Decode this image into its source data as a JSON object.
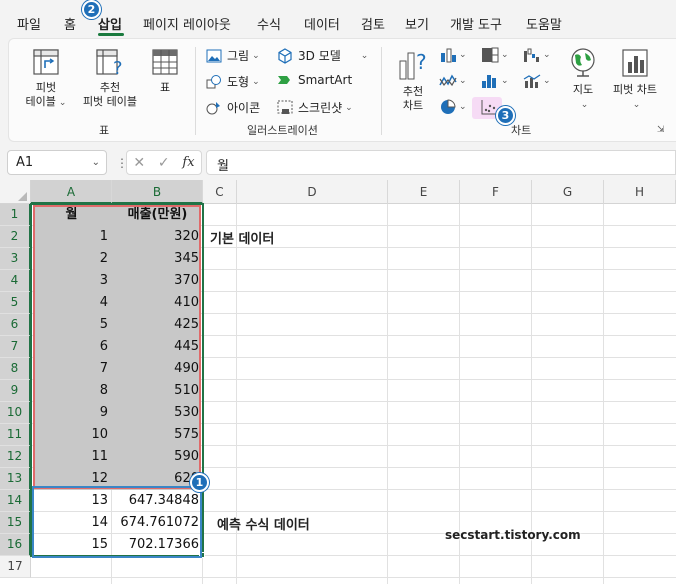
{
  "menu": {
    "tabs": [
      "파일",
      "홈",
      "삽입",
      "페이지 레이아웃",
      "수식",
      "데이터",
      "검토",
      "보기",
      "개발 도구",
      "도움말"
    ],
    "active_tab": "삽입"
  },
  "ribbon": {
    "tables_group": {
      "label": "표",
      "pivot_table": "피벗\n테이블",
      "recommended_pivot": "추천\n피벗 테이블",
      "table": "표"
    },
    "illustrations_group": {
      "label": "일러스트레이션",
      "picture": "그림",
      "shapes": "도형",
      "icons": "아이콘",
      "models_3d": "3D 모델",
      "smartart": "SmartArt",
      "screenshot": "스크린샷"
    },
    "charts_group": {
      "label": "차트",
      "recommended_charts": "추천\n차트",
      "maps": "지도",
      "pivot_chart": "피벗 차트"
    }
  },
  "formula_bar": {
    "name_box": "A1",
    "formula": "월"
  },
  "sheet": {
    "columns": [
      "A",
      "B",
      "C",
      "D",
      "E",
      "F",
      "G",
      "H"
    ],
    "rows": [
      "1",
      "2",
      "3",
      "4",
      "5",
      "6",
      "7",
      "8",
      "9",
      "10",
      "11",
      "12",
      "13",
      "14",
      "15",
      "16",
      "17"
    ],
    "header": [
      "월",
      "매출(만원)"
    ],
    "data": [
      [
        "1",
        "320"
      ],
      [
        "2",
        "345"
      ],
      [
        "3",
        "370"
      ],
      [
        "4",
        "410"
      ],
      [
        "5",
        "425"
      ],
      [
        "6",
        "445"
      ],
      [
        "7",
        "490"
      ],
      [
        "8",
        "510"
      ],
      [
        "9",
        "530"
      ],
      [
        "10",
        "575"
      ],
      [
        "11",
        "590"
      ],
      [
        "12",
        "620"
      ],
      [
        "13",
        "647.34848"
      ],
      [
        "14",
        "674.761072"
      ],
      [
        "15",
        "702.17366"
      ]
    ]
  },
  "annotations": {
    "base_data": "기본 데이터",
    "forecast_data": "예측 수식 데이터",
    "watermark": "secstart.tistory.com",
    "badge1": "1",
    "badge2": "2",
    "badge3": "3"
  },
  "colors": {
    "excel_green": "#217346",
    "red_box": "#e06a6a",
    "blue_box": "#3a86c6",
    "badge": "#1f6fb8",
    "scatter_highlight": "#f6dbf5"
  }
}
